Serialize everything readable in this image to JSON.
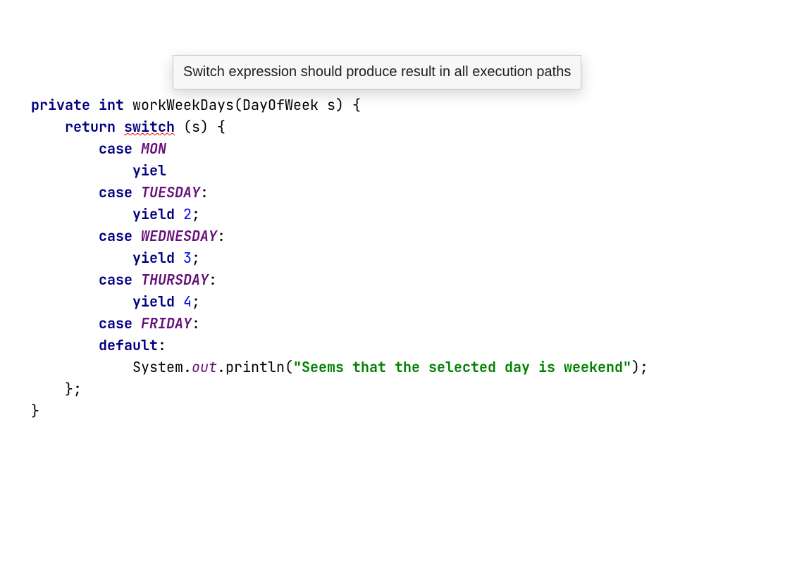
{
  "code": {
    "l1_private": "private",
    "l1_int": "int",
    "l1_method": " workWeekDays(DayOfWeek s) {",
    "l2_return": "return",
    "l2_switch": "switch",
    "l2_tail": " (s) {",
    "l3_case": "case",
    "l3_const": "MON",
    "l4_yield": "yiel",
    "l5_case": "case",
    "l5_const": "TUESDAY",
    "l5_colon": ":",
    "l6_yield": "yield",
    "l6_num": "2",
    "l6_semi": ";",
    "l7_case": "case",
    "l7_const": "WEDNESDAY",
    "l7_colon": ":",
    "l8_yield": "yield",
    "l8_num": "3",
    "l8_semi": ";",
    "l9_case": "case",
    "l9_const": "THURSDAY",
    "l9_colon": ":",
    "l10_yield": "yield",
    "l10_num": "4",
    "l10_semi": ";",
    "l11_case": "case",
    "l11_const": "FRIDAY",
    "l11_colon": ":",
    "l12_default": "default",
    "l12_colon": ":",
    "l13_sys": "System.",
    "l13_out": "out",
    "l13_println": ".println(",
    "l13_str": "\"Seems that the selected day is weekend\"",
    "l13_close": ");",
    "l14": "};",
    "l15": "}"
  },
  "tooltip": {
    "text": "Switch expression should produce result in all execution paths"
  }
}
